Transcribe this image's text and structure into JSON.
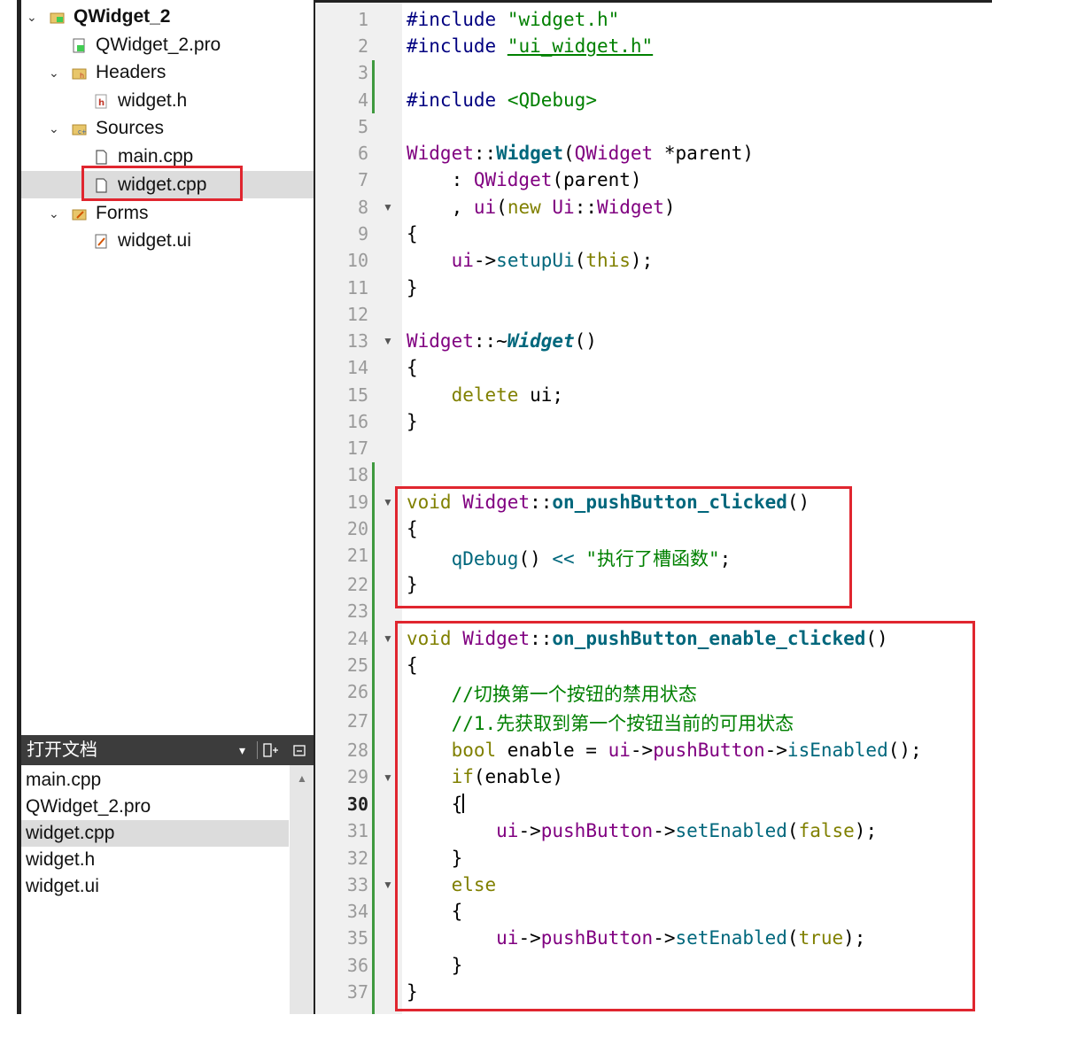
{
  "project_tree": {
    "root": "QWidget_2",
    "pro_file": "QWidget_2.pro",
    "headers_label": "Headers",
    "header_file": "widget.h",
    "sources_label": "Sources",
    "source_files": [
      "main.cpp",
      "widget.cpp"
    ],
    "forms_label": "Forms",
    "form_file": "widget.ui"
  },
  "open_documents": {
    "title": "打开文档",
    "items": [
      "main.cpp",
      "QWidget_2.pro",
      "widget.cpp",
      "widget.h",
      "widget.ui"
    ],
    "selected": "widget.cpp"
  },
  "editor": {
    "current_line": 30,
    "line_numbers": [
      "1",
      "2",
      "3",
      "4",
      "5",
      "6",
      "7",
      "8",
      "9",
      "10",
      "11",
      "12",
      "13",
      "14",
      "15",
      "16",
      "17",
      "18",
      "19",
      "20",
      "21",
      "22",
      "23",
      "24",
      "25",
      "26",
      "27",
      "28",
      "29",
      "30",
      "31",
      "32",
      "33",
      "34",
      "35",
      "36",
      "37"
    ],
    "lines": {
      "l1": [
        "#include",
        "\"widget.h\""
      ],
      "l2": [
        "#include",
        "\"ui_widget.h\""
      ],
      "l4": [
        "#include",
        "<QDebug>"
      ],
      "l6": [
        "Widget",
        "::",
        "Widget",
        "(",
        "QWidget",
        " *parent)"
      ],
      "l7": [
        "    : ",
        "QWidget",
        "(parent)"
      ],
      "l8": [
        "    , ",
        "ui",
        "(",
        "new",
        " ",
        "Ui",
        "::",
        "Widget",
        ")"
      ],
      "l9": "{",
      "l10": [
        "    ",
        "ui",
        "->",
        "setupUi",
        "(",
        "this",
        ");"
      ],
      "l11": "}",
      "l13": [
        "Widget",
        "::~",
        "Widget",
        "()"
      ],
      "l14": "{",
      "l15": [
        "    ",
        "delete",
        " ui;"
      ],
      "l16": "}",
      "l19": [
        "void",
        " ",
        "Widget",
        "::",
        "on_pushButton_clicked",
        "()"
      ],
      "l20": "{",
      "l21": [
        "    ",
        "qDebug",
        "() ",
        "<<",
        " ",
        "\"执行了槽函数\"",
        ";"
      ],
      "l22": "}",
      "l24": [
        "void",
        " ",
        "Widget",
        "::",
        "on_pushButton_enable_clicked",
        "()"
      ],
      "l25": "{",
      "l26": "    //切换第一个按钮的禁用状态",
      "l27": "    //1.先获取到第一个按钮当前的可用状态",
      "l28": [
        "    ",
        "bool",
        " enable = ",
        "ui",
        "->",
        "pushButton",
        "->",
        "isEnabled",
        "();"
      ],
      "l29": [
        "    ",
        "if",
        "(enable)"
      ],
      "l30": "    {",
      "l31": [
        "        ",
        "ui",
        "->",
        "pushButton",
        "->",
        "setEnabled",
        "(",
        "false",
        ");"
      ],
      "l32": "    }",
      "l33": [
        "    ",
        "else"
      ],
      "l34": "    {",
      "l35": [
        "        ",
        "ui",
        "->",
        "pushButton",
        "->",
        "setEnabled",
        "(",
        "true",
        ");"
      ],
      "l36": "    }",
      "l37": "}"
    }
  },
  "colors": {
    "highlight_box": "#e0262f",
    "preprocessor": "#000080",
    "string": "#008000",
    "keyword": "#808000",
    "type": "#800080",
    "function": "#00677c"
  },
  "icons": {
    "root": "qt-project-icon",
    "folder": "folder-icon",
    "file": "file-icon"
  }
}
